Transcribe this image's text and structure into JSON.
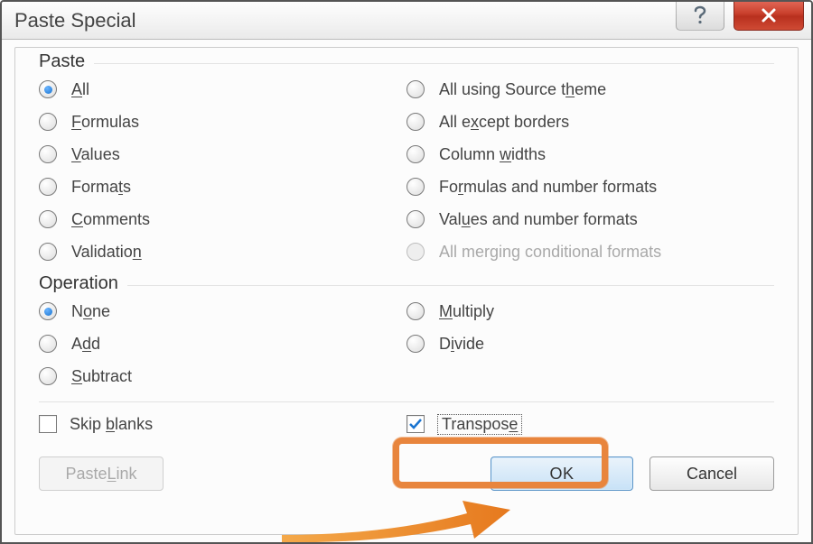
{
  "window": {
    "title": "Paste Special"
  },
  "groups": {
    "paste": {
      "label": "Paste",
      "left": [
        {
          "pre": "",
          "u": "A",
          "post": "ll",
          "checked": true
        },
        {
          "pre": "",
          "u": "F",
          "post": "ormulas",
          "checked": false
        },
        {
          "pre": "",
          "u": "V",
          "post": "alues",
          "checked": false
        },
        {
          "pre": "Forma",
          "u": "t",
          "post": "s",
          "checked": false
        },
        {
          "pre": "",
          "u": "C",
          "post": "omments",
          "checked": false
        },
        {
          "pre": "Validatio",
          "u": "n",
          "post": "",
          "checked": false
        }
      ],
      "right": [
        {
          "pre": "All using Source t",
          "u": "h",
          "post": "eme",
          "checked": false,
          "disabled": false
        },
        {
          "pre": "All e",
          "u": "x",
          "post": "cept borders",
          "checked": false,
          "disabled": false
        },
        {
          "pre": "Column ",
          "u": "w",
          "post": "idths",
          "checked": false,
          "disabled": false
        },
        {
          "pre": "Fo",
          "u": "r",
          "post": "mulas and number formats",
          "checked": false,
          "disabled": false
        },
        {
          "pre": "Val",
          "u": "u",
          "post": "es and number formats",
          "checked": false,
          "disabled": false
        },
        {
          "pre": "All mer",
          "u": "g",
          "post": "ing conditional formats",
          "checked": false,
          "disabled": true
        }
      ]
    },
    "operation": {
      "label": "Operation",
      "left": [
        {
          "pre": "N",
          "u": "o",
          "post": "ne",
          "checked": true
        },
        {
          "pre": "A",
          "u": "d",
          "post": "d",
          "checked": false
        },
        {
          "pre": "",
          "u": "S",
          "post": "ubtract",
          "checked": false
        }
      ],
      "right": [
        {
          "pre": "",
          "u": "M",
          "post": "ultiply",
          "checked": false
        },
        {
          "pre": "D",
          "u": "i",
          "post": "vide",
          "checked": false
        }
      ]
    }
  },
  "checks": {
    "skip_blanks": {
      "pre": "Skip ",
      "u": "b",
      "post": "lanks",
      "checked": false
    },
    "transpose": {
      "pre": "Transpos",
      "u": "e",
      "post": "",
      "checked": true
    }
  },
  "buttons": {
    "paste_link": {
      "pre": "Paste ",
      "u": "L",
      "post": "ink"
    },
    "ok": "OK",
    "cancel": "Cancel"
  }
}
